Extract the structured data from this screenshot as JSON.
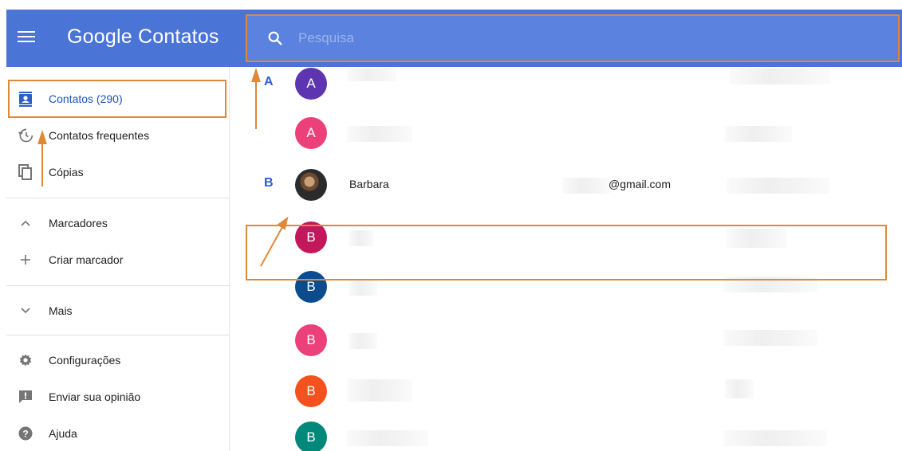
{
  "header": {
    "title": "Google Contatos",
    "search_placeholder": "Pesquisa"
  },
  "sidebar": {
    "items": [
      {
        "label": "Contatos (290)",
        "icon": "contacts-icon"
      },
      {
        "label": "Contatos frequentes",
        "icon": "history-icon"
      },
      {
        "label": "Cópias",
        "icon": "copy-icon"
      },
      {
        "label": "Marcadores",
        "icon": "chevron-up-icon"
      },
      {
        "label": "Criar marcador",
        "icon": "plus-icon"
      },
      {
        "label": "Mais",
        "icon": "chevron-down-icon"
      },
      {
        "label": "Configurações",
        "icon": "gear-icon"
      },
      {
        "label": "Enviar sua opinião",
        "icon": "feedback-icon"
      },
      {
        "label": "Ajuda",
        "icon": "help-icon"
      }
    ]
  },
  "contacts": [
    {
      "section": "A",
      "initial": "A",
      "color": "#5e35b1",
      "name": "",
      "email": ""
    },
    {
      "section": "",
      "initial": "A",
      "color": "#ec407a",
      "name": "",
      "email": ""
    },
    {
      "section": "B",
      "initial": "",
      "color": "#333333",
      "name": "Barbara",
      "email": "@gmail.com"
    },
    {
      "section": "",
      "initial": "B",
      "color": "#c2185b",
      "name": "",
      "email": ""
    },
    {
      "section": "",
      "initial": "B",
      "color": "#0d4c8c",
      "name": "",
      "email": ""
    },
    {
      "section": "",
      "initial": "B",
      "color": "#ec407a",
      "name": "",
      "email": ""
    },
    {
      "section": "",
      "initial": "B",
      "color": "#f4511e",
      "name": "",
      "email": ""
    },
    {
      "section": "",
      "initial": "B",
      "color": "#00897b",
      "name": "",
      "email": ""
    }
  ],
  "colors": {
    "header_bg": "#4a74d6",
    "search_bg": "#5a82de",
    "accent_blue": "#2d5fc9",
    "annotation_orange": "#e0883a"
  }
}
